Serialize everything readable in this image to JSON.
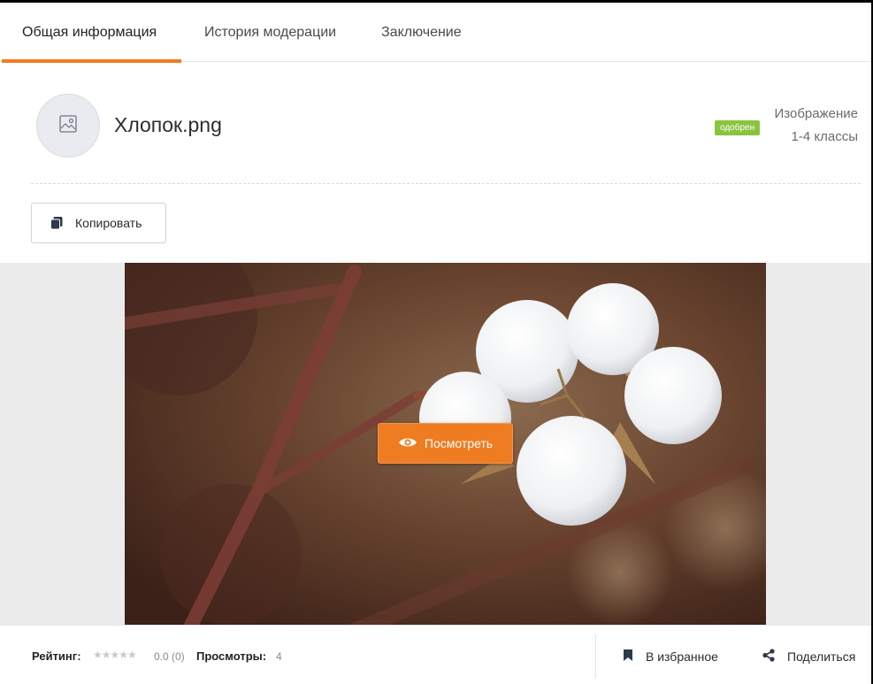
{
  "tabs": [
    {
      "label": "Общая информация",
      "active": true
    },
    {
      "label": "История модерации",
      "active": false
    },
    {
      "label": "Заключение",
      "active": false
    }
  ],
  "resource": {
    "title": "Хлопок.png",
    "icon": "image-icon",
    "status": "одобрен",
    "type": "Изображение",
    "grade": "1-4 классы"
  },
  "actions": {
    "copy_label": "Копировать",
    "copy_icon": "copy-icon",
    "view_label": "Посмотреть",
    "view_icon": "eye-icon"
  },
  "preview": {
    "image_icon": "cotton-photo"
  },
  "footer": {
    "rating_label": "Рейтинг:",
    "rating_stars": "★★★★★",
    "rating_value": "0.0 (0)",
    "views_label": "Просмотры:",
    "views_value": "4",
    "favorite_label": "В избранное",
    "favorite_icon": "bookmark-icon",
    "share_label": "Поделиться",
    "share_icon": "share-icon"
  },
  "colors": {
    "accent": "#f07c21",
    "approved": "#8ac43f"
  }
}
